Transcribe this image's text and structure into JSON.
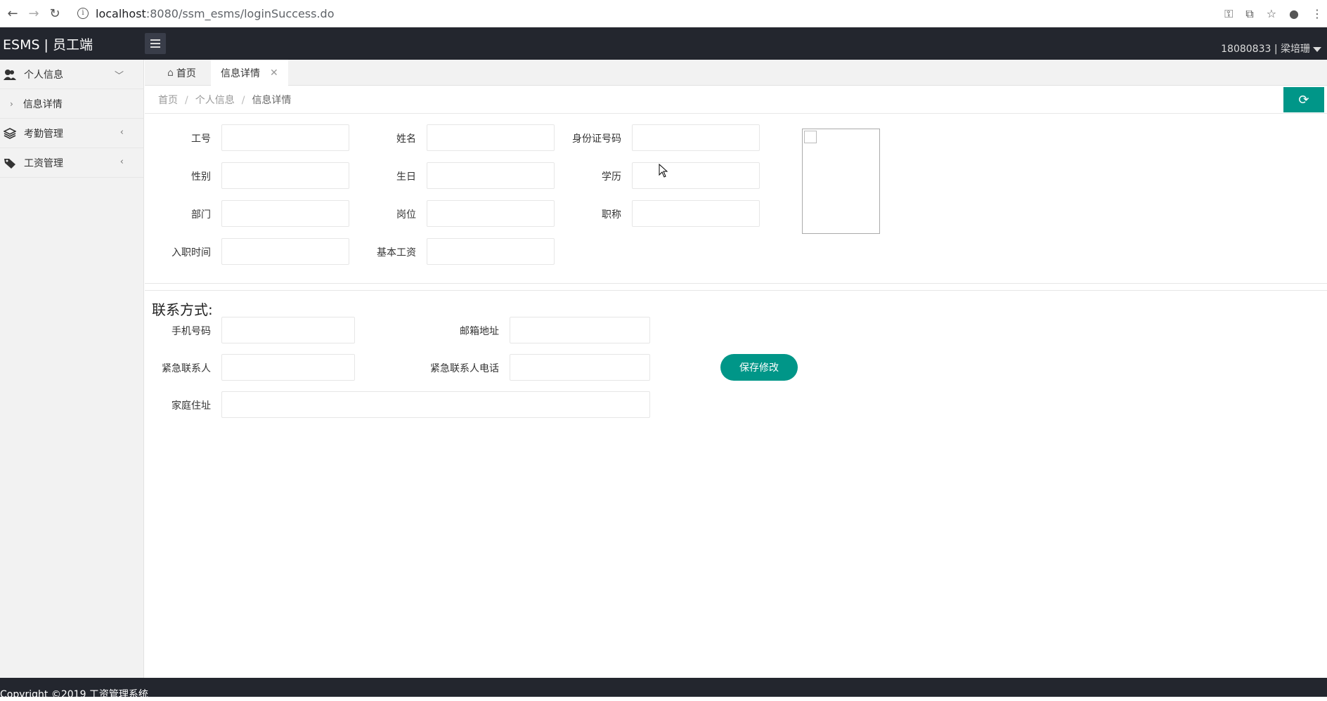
{
  "browser": {
    "url_host": "localhost",
    "url_rest": ":8080/ssm_esms/loginSuccess.do"
  },
  "header": {
    "logo": "ESMS | 员工端",
    "user": "18080833 | 梁培珊"
  },
  "sidebar": {
    "items": [
      {
        "label": "个人信息",
        "icon": "users-icon",
        "expanded": true,
        "children": [
          {
            "label": "信息详情"
          }
        ]
      },
      {
        "label": "考勤管理",
        "icon": "layers-icon",
        "expanded": false
      },
      {
        "label": "工资管理",
        "icon": "tag-icon",
        "expanded": false
      }
    ]
  },
  "tabs": [
    {
      "label": "首页",
      "icon": "home-icon"
    },
    {
      "label": "信息详情",
      "active": true
    }
  ],
  "breadcrumb": [
    "首页",
    "个人信息",
    "信息详情"
  ],
  "form": {
    "emp_id": {
      "label": "工号",
      "value": ""
    },
    "name": {
      "label": "姓名",
      "value": ""
    },
    "id_card": {
      "label": "身份证号码",
      "value": ""
    },
    "gender": {
      "label": "性别",
      "value": ""
    },
    "birthday": {
      "label": "生日",
      "value": ""
    },
    "education": {
      "label": "学历",
      "value": ""
    },
    "department": {
      "label": "部门",
      "value": ""
    },
    "position": {
      "label": "岗位",
      "value": ""
    },
    "title": {
      "label": "职称",
      "value": ""
    },
    "hire_date": {
      "label": "入职时间",
      "value": ""
    },
    "base_salary": {
      "label": "基本工资",
      "value": ""
    }
  },
  "contact": {
    "section_title": "联系方式:",
    "phone": {
      "label": "手机号码",
      "value": ""
    },
    "email": {
      "label": "邮箱地址",
      "value": ""
    },
    "emergency_contact": {
      "label": "紧急联系人",
      "value": ""
    },
    "emergency_phone": {
      "label": "紧急联系人电话",
      "value": ""
    },
    "address": {
      "label": "家庭住址",
      "value": ""
    },
    "save_label": "保存修改"
  },
  "footer": {
    "copyright": "Copyright ©2019 工资管理系统"
  },
  "colors": {
    "accent": "#009688",
    "header_bg": "#23262e",
    "sidebar_bg": "#f2f2f2"
  }
}
